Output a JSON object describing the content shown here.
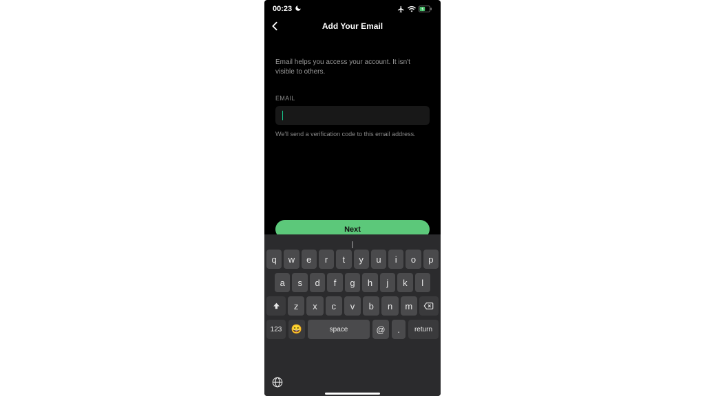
{
  "status": {
    "time": "00:23"
  },
  "header": {
    "title": "Add Your Email"
  },
  "form": {
    "helper": "Email helps you access your account. It isn't visible to others.",
    "label": "EMAIL",
    "value": "",
    "hint": "We'll send a verification code to this email address.",
    "next": "Next"
  },
  "kb": {
    "r1": [
      "q",
      "w",
      "e",
      "r",
      "t",
      "y",
      "u",
      "i",
      "o",
      "p"
    ],
    "r2": [
      "a",
      "s",
      "d",
      "f",
      "g",
      "h",
      "j",
      "k",
      "l"
    ],
    "r3": [
      "z",
      "x",
      "c",
      "v",
      "b",
      "n",
      "m"
    ],
    "mode": "123",
    "emoji": "😀",
    "space": "space",
    "at": "@",
    "dot": ".",
    "return": "return"
  }
}
